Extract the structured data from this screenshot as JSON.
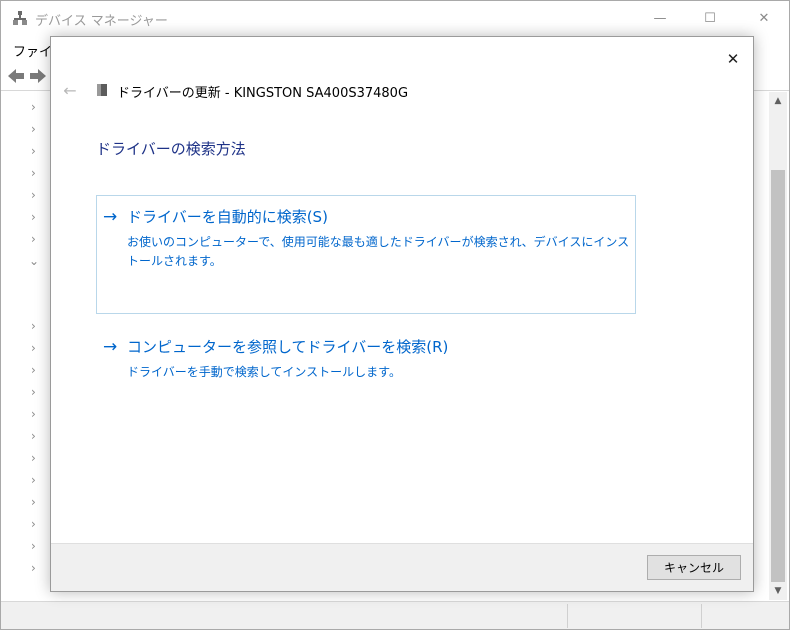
{
  "background_window": {
    "title": "デバイス マネージャー",
    "menu_file": "ファイル",
    "minimize_glyph": "—",
    "maximize_glyph": "☐",
    "close_glyph": "✕"
  },
  "dialog": {
    "close_glyph": "✕",
    "back_glyph": "←",
    "title": "ドライバーの更新 - KINGSTON SA400S37480G",
    "heading": "ドライバーの検索方法",
    "option_auto": {
      "arrow": "→",
      "title": "ドライバーを自動的に検索(S)",
      "description": "お使いのコンピューターで、使用可能な最も適したドライバーが検索され、デバイスにインストールされます。"
    },
    "option_browse": {
      "arrow": "→",
      "title": "コンピューターを参照してドライバーを検索(R)",
      "description": "ドライバーを手動で検索してインストールします。"
    },
    "cancel_label": "キャンセル"
  },
  "icons": [
    "device-manager-icon",
    "back-arrow-icon",
    "forward-arrow-icon",
    "chevron-right-icon",
    "chevron-down-icon",
    "drive-icon",
    "close-icon",
    "arrow-right-icon"
  ],
  "colors": {
    "heading": "#1e3287",
    "link": "#0066cc",
    "option_border": "#b9d7ea",
    "footer": "#f0f0f0"
  }
}
